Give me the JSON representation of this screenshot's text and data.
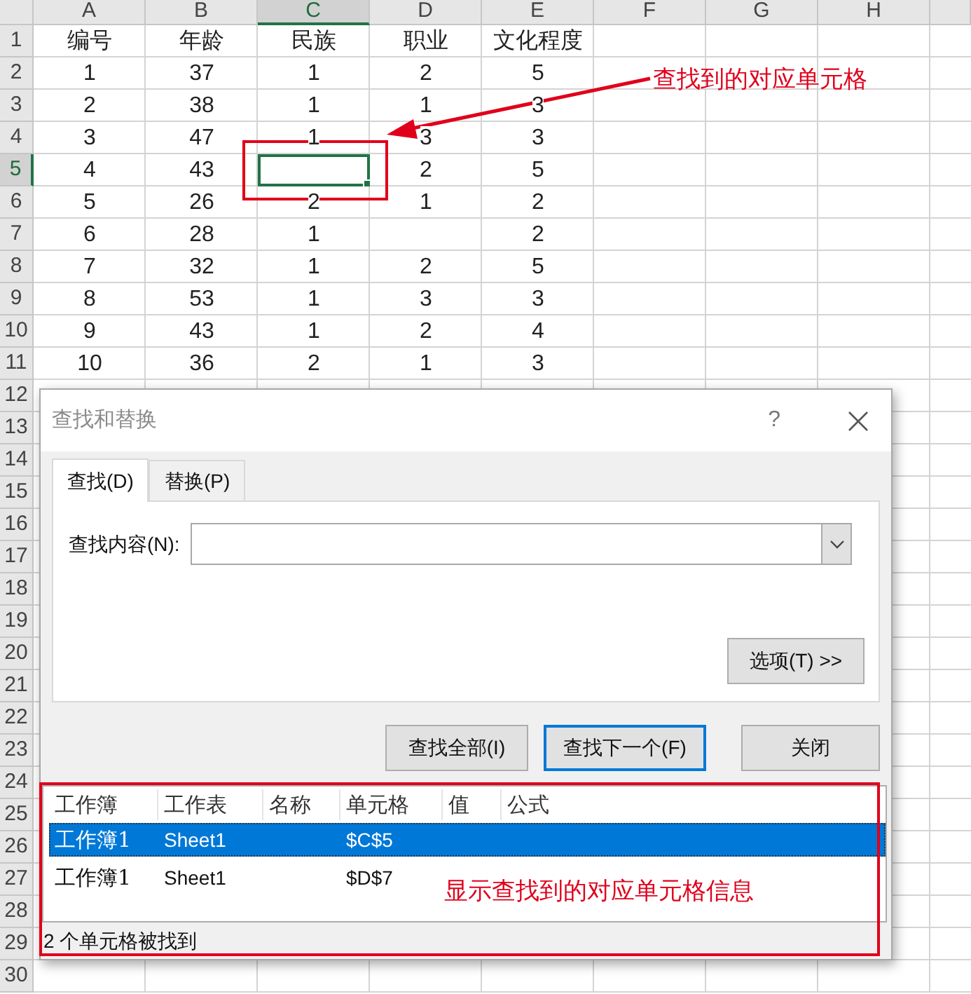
{
  "sheet": {
    "columns": [
      "A",
      "B",
      "C",
      "D",
      "E",
      "F",
      "G",
      "H"
    ],
    "rows": [
      {
        "number": "1",
        "cells": [
          {
            "text": "编号",
            "selected": false
          },
          {
            "text": "年龄",
            "selected": false
          },
          {
            "text": "民族",
            "selected": false
          },
          {
            "text": "职业",
            "selected": false
          },
          {
            "text": "文化程度",
            "selected": false
          }
        ]
      },
      {
        "number": "2",
        "cells": [
          {
            "text": "1",
            "selected": false
          },
          {
            "text": "37",
            "selected": false
          },
          {
            "text": "1",
            "selected": false
          },
          {
            "text": "2",
            "selected": false
          },
          {
            "text": "5",
            "selected": false
          }
        ]
      },
      {
        "number": "3",
        "cells": [
          {
            "text": "2",
            "selected": false
          },
          {
            "text": "38",
            "selected": false
          },
          {
            "text": "1",
            "selected": false
          },
          {
            "text": "1",
            "selected": false
          },
          {
            "text": "3",
            "selected": false
          }
        ]
      },
      {
        "number": "4",
        "cells": [
          {
            "text": "3",
            "selected": false
          },
          {
            "text": "47",
            "selected": false
          },
          {
            "text": "1",
            "selected": false
          },
          {
            "text": "3",
            "selected": false
          },
          {
            "text": "3",
            "selected": false
          }
        ]
      },
      {
        "number": "5",
        "cells": [
          {
            "text": "4",
            "selected": false
          },
          {
            "text": "43",
            "selected": false
          },
          {
            "selected": true
          },
          {
            "text": "2",
            "selected": false
          },
          {
            "text": "5",
            "selected": false
          }
        ]
      },
      {
        "number": "6",
        "cells": [
          {
            "text": "5",
            "selected": false
          },
          {
            "text": "26",
            "selected": false
          },
          {
            "text": "2",
            "selected": false
          },
          {
            "text": "1",
            "selected": false
          },
          {
            "text": "2",
            "selected": false
          }
        ]
      },
      {
        "number": "7",
        "cells": [
          {
            "text": "6",
            "selected": false
          },
          {
            "text": "28",
            "selected": false
          },
          {
            "text": "1",
            "selected": false
          },
          {
            "selected": false
          },
          {
            "text": "2",
            "selected": false
          }
        ]
      },
      {
        "number": "8",
        "cells": [
          {
            "text": "7",
            "selected": false
          },
          {
            "text": "32",
            "selected": false
          },
          {
            "text": "1",
            "selected": false
          },
          {
            "text": "2",
            "selected": false
          },
          {
            "text": "5",
            "selected": false
          }
        ]
      },
      {
        "number": "9",
        "cells": [
          {
            "text": "8",
            "selected": false
          },
          {
            "text": "53",
            "selected": false
          },
          {
            "text": "1",
            "selected": false
          },
          {
            "text": "3",
            "selected": false
          },
          {
            "text": "3",
            "selected": false
          }
        ]
      },
      {
        "number": "10",
        "cells": [
          {
            "text": "9",
            "selected": false
          },
          {
            "text": "43",
            "selected": false
          },
          {
            "text": "1",
            "selected": false
          },
          {
            "text": "2",
            "selected": false
          },
          {
            "text": "4",
            "selected": false
          }
        ]
      },
      {
        "number": "11",
        "cells": [
          {
            "text": "10",
            "selected": false
          },
          {
            "text": "36",
            "selected": false
          },
          {
            "text": "2",
            "selected": false
          },
          {
            "text": "1",
            "selected": false
          },
          {
            "text": "3",
            "selected": false
          }
        ]
      },
      {
        "number": "12",
        "cells": []
      },
      {
        "number": "13",
        "cells": []
      },
      {
        "number": "14",
        "cells": []
      },
      {
        "number": "15",
        "cells": []
      },
      {
        "number": "16",
        "cells": []
      },
      {
        "number": "17",
        "cells": []
      },
      {
        "number": "18",
        "cells": []
      },
      {
        "number": "19",
        "cells": []
      },
      {
        "number": "20",
        "cells": []
      },
      {
        "number": "21",
        "cells": []
      },
      {
        "number": "22",
        "cells": []
      },
      {
        "number": "23",
        "cells": []
      },
      {
        "number": "24",
        "cells": []
      },
      {
        "number": "25",
        "cells": []
      },
      {
        "number": "26",
        "cells": []
      },
      {
        "number": "27",
        "cells": []
      },
      {
        "number": "28",
        "cells": []
      },
      {
        "number": "29",
        "cells": []
      },
      {
        "number": "30",
        "cells": []
      }
    ]
  },
  "dialog": {
    "title": "查找和替换",
    "help": "?",
    "tabs": [
      {
        "label": "查找(D)",
        "selected": true
      },
      {
        "label": "替换(P)",
        "selected": false
      }
    ],
    "find_label": "查找内容(N):",
    "options_button": "选项(T) >>",
    "buttons": [
      {
        "label": "查找全部(I)",
        "default": false
      },
      {
        "label": "查找下一个(F)",
        "default": true
      },
      {
        "label": "关闭",
        "default": false
      }
    ],
    "results": {
      "columns": [
        "工作簿",
        "工作表",
        "名称",
        "单元格",
        "值",
        "公式"
      ],
      "rows": [
        {
          "cells": [
            "工作簿1",
            "Sheet1",
            "",
            "$C$5",
            "",
            ""
          ],
          "selected": true
        },
        {
          "cells": [
            "工作簿1",
            "Sheet1",
            "",
            "$D$7",
            "",
            ""
          ],
          "selected": false
        }
      ]
    },
    "status": "2 个单元格被找到"
  },
  "annotations": [
    {
      "text": "查找到的对应单元格"
    },
    {
      "text": "显示查找到的对应单元格信息"
    }
  ]
}
